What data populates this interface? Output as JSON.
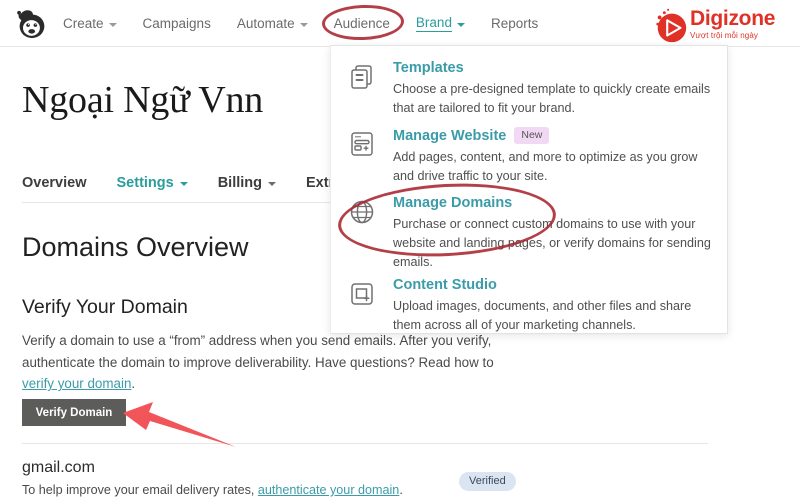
{
  "topnav": {
    "logo_icon": "mailchimp-freddie-logo",
    "items": [
      {
        "label": "Create",
        "has_caret": true,
        "active": false
      },
      {
        "label": "Campaigns",
        "has_caret": false,
        "active": false
      },
      {
        "label": "Automate",
        "has_caret": true,
        "active": false
      },
      {
        "label": "Audience",
        "has_caret": false,
        "active": false
      },
      {
        "label": "Brand",
        "has_caret": true,
        "active": true
      },
      {
        "label": "Reports",
        "has_caret": false,
        "active": false
      }
    ]
  },
  "watermark": {
    "name": "Digizone",
    "tagline": "Vượt trội mỗi ngày",
    "color": "#e03127"
  },
  "account": {
    "brand_name": "Ngoại Ngữ Vnn"
  },
  "subtabs": [
    {
      "label": "Overview",
      "has_caret": false,
      "active": false
    },
    {
      "label": "Settings",
      "has_caret": true,
      "active": true
    },
    {
      "label": "Billing",
      "has_caret": true,
      "active": false
    },
    {
      "label": "Extras",
      "has_caret": true,
      "active": false
    }
  ],
  "page": {
    "title": "Domains Overview",
    "section_title": "Verify Your Domain",
    "paragraph_part1": "Verify a domain to use a “from” address when you send emails. After you verify, authenticate the domain to improve deliverability. Have questions? Read how to ",
    "paragraph_link": "verify your domain",
    "paragraph_end": ".",
    "verify_button": "Verify Domain"
  },
  "domain_row": {
    "name": "gmail.com",
    "desc_part1": "To help improve your email delivery rates, ",
    "desc_link": "authenticate your domain",
    "desc_end": ".",
    "status_badge": "Verified"
  },
  "dropdown": {
    "items": [
      {
        "icon": "templates-icon",
        "title": "Templates",
        "badge": "",
        "desc": "Choose a pre-designed template to quickly create emails that are tailored to fit your brand."
      },
      {
        "icon": "website-icon",
        "title": "Manage Website",
        "badge": "New",
        "desc": "Add pages, content, and more to optimize as you grow and drive traffic to your site."
      },
      {
        "icon": "globe-icon",
        "title": "Manage Domains",
        "badge": "",
        "desc": "Purchase or connect custom domains to use with your website and landing pages, or verify domains for sending emails."
      },
      {
        "icon": "content-studio-icon",
        "title": "Content Studio",
        "badge": "",
        "desc": "Upload images, documents, and other files and share them across all of your marketing channels."
      }
    ]
  },
  "annotations": {
    "ellipse_color": "#a8262f",
    "arrow_color": "#f1555a",
    "circled_nav_item": "Brand",
    "circled_menu_item": "Manage Domains",
    "arrow_target": "Verify Domain"
  }
}
